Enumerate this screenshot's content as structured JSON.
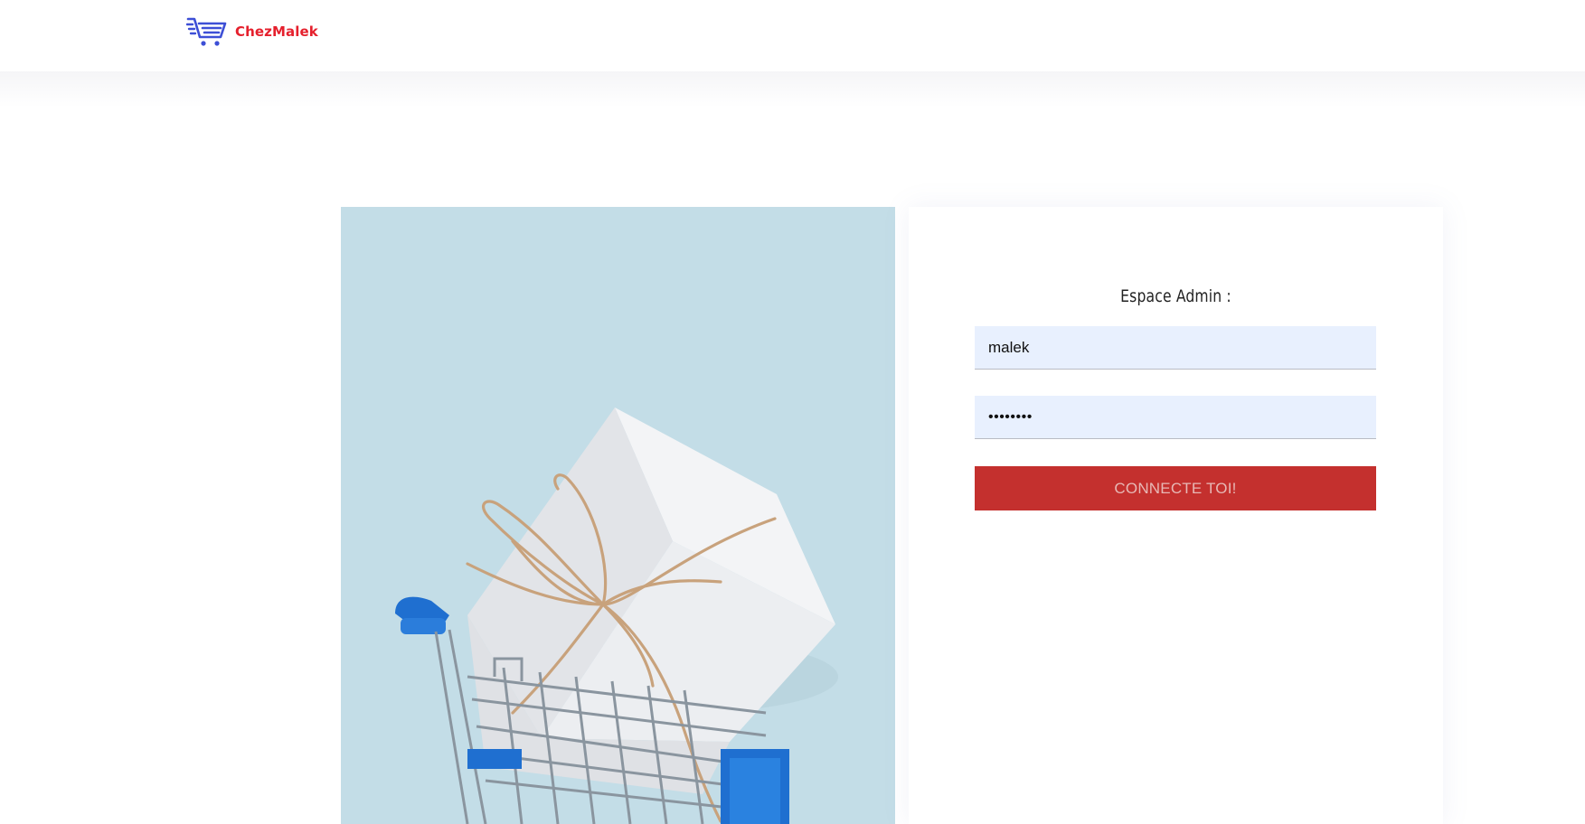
{
  "header": {
    "brand": "ChezMalek",
    "logo_icon": "shopping-cart-icon",
    "brand_color": "#e5202d",
    "icon_color": "#3d4fd6"
  },
  "hero_image": {
    "subject": "white gift box tied with twine in a blue shopping cart",
    "background_color": "#c3dde7"
  },
  "login": {
    "title": "Espace Admin :",
    "username_value": "malek",
    "password_value": "••••••••",
    "submit_label": "CONNECTE TOI!",
    "button_color": "#c4302e",
    "field_color": "#e8f0fe"
  }
}
